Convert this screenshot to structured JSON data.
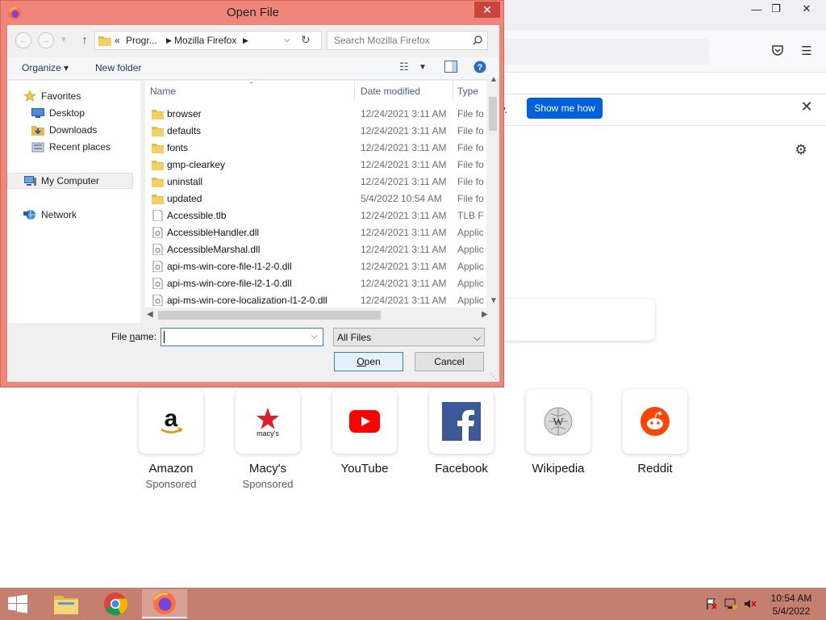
{
  "dialog": {
    "title": "Open File",
    "address": {
      "overflow": "«",
      "segments": [
        "Progr...",
        "Mozilla Firefox"
      ]
    },
    "search_placeholder": "Search Mozilla Firefox",
    "commands": {
      "organize": "Organize",
      "new_folder": "New folder"
    },
    "nav": {
      "favorites": "Favorites",
      "desktop": "Desktop",
      "downloads": "Downloads",
      "recent": "Recent places",
      "computer": "My Computer",
      "network": "Network"
    },
    "columns": {
      "name": "Name",
      "date": "Date modified",
      "type": "Type"
    },
    "files": [
      {
        "name": "browser",
        "date": "12/24/2021 3:11 AM",
        "type": "File fol",
        "kind": "folder"
      },
      {
        "name": "defaults",
        "date": "12/24/2021 3:11 AM",
        "type": "File fol",
        "kind": "folder"
      },
      {
        "name": "fonts",
        "date": "12/24/2021 3:11 AM",
        "type": "File fol",
        "kind": "folder"
      },
      {
        "name": "gmp-clearkey",
        "date": "12/24/2021 3:11 AM",
        "type": "File fol",
        "kind": "folder"
      },
      {
        "name": "uninstall",
        "date": "12/24/2021 3:11 AM",
        "type": "File fol",
        "kind": "folder"
      },
      {
        "name": "updated",
        "date": "5/4/2022 10:54 AM",
        "type": "File fol",
        "kind": "folder"
      },
      {
        "name": "Accessible.tlb",
        "date": "12/24/2021 3:11 AM",
        "type": "TLB Fil",
        "kind": "file"
      },
      {
        "name": "AccessibleHandler.dll",
        "date": "12/24/2021 3:11 AM",
        "type": "Applic",
        "kind": "dll"
      },
      {
        "name": "AccessibleMarshal.dll",
        "date": "12/24/2021 3:11 AM",
        "type": "Applic",
        "kind": "dll"
      },
      {
        "name": "api-ms-win-core-file-l1-2-0.dll",
        "date": "12/24/2021 3:11 AM",
        "type": "Applic",
        "kind": "dll"
      },
      {
        "name": "api-ms-win-core-file-l2-1-0.dll",
        "date": "12/24/2021 3:11 AM",
        "type": "Applic",
        "kind": "dll"
      },
      {
        "name": "api-ms-win-core-localization-l1-2-0.dll",
        "date": "12/24/2021 3:11 AM",
        "type": "Applic",
        "kind": "dll"
      }
    ],
    "filename_label_pre": "File ",
    "filename_label_u": "n",
    "filename_label_post": "ame:",
    "filename_value": "",
    "filter": "All Files",
    "open_pre": "",
    "open_u": "O",
    "open_post": "pen",
    "cancel": "Cancel"
  },
  "firefox": {
    "notification_fragment": "y.",
    "show_me_how": "Show me how",
    "top_sites": [
      {
        "title": "Amazon",
        "sub": "Sponsored",
        "icon": "amazon-logo"
      },
      {
        "title": "Macy's",
        "sub": "Sponsored",
        "icon": "macys-logo"
      },
      {
        "title": "YouTube",
        "sub": "",
        "icon": "youtube-logo"
      },
      {
        "title": "Facebook",
        "sub": "",
        "icon": "facebook-logo"
      },
      {
        "title": "Wikipedia",
        "sub": "",
        "icon": "wikipedia-logo"
      },
      {
        "title": "Reddit",
        "sub": "",
        "icon": "reddit-logo"
      }
    ]
  },
  "taskbar": {
    "time": "10:54 AM",
    "date": "5/4/2022"
  },
  "colors": {
    "dialog_frame": "#f08679",
    "dialog_close": "#c7453a",
    "accent_button": "#0061e0",
    "taskbar": "#c57f6e"
  }
}
